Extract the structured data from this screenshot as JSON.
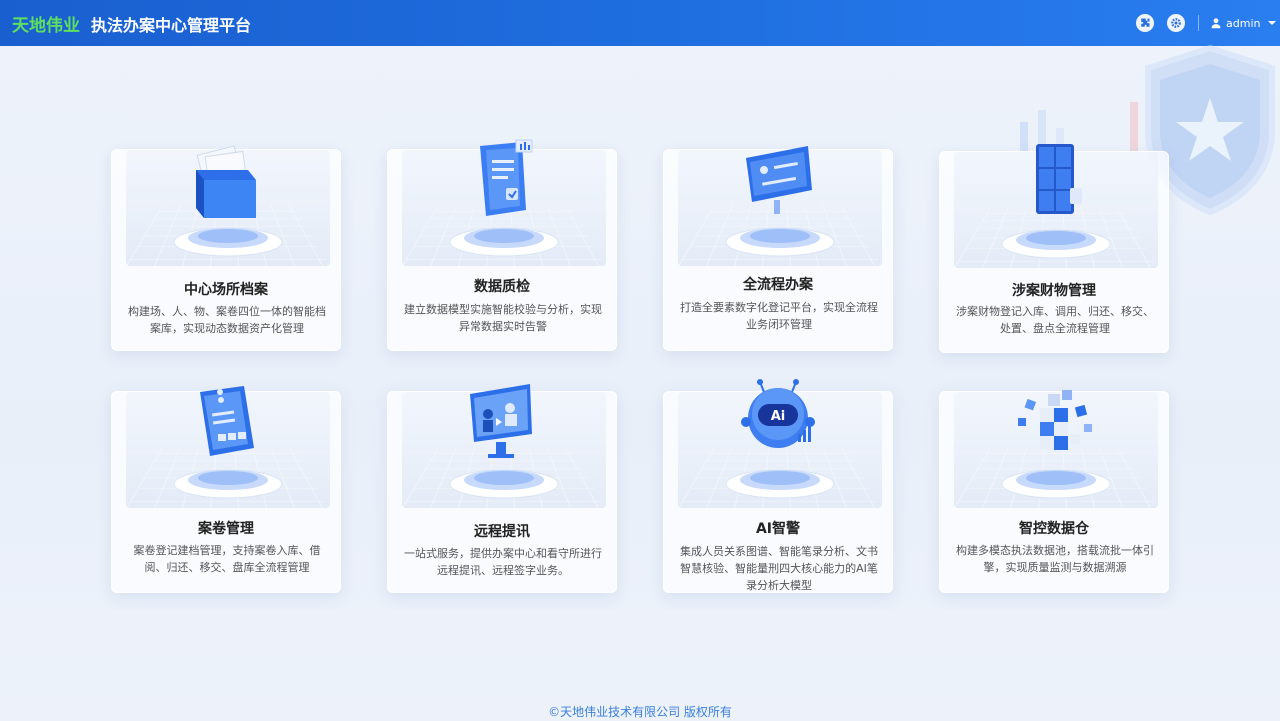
{
  "header": {
    "brand": "天地伟业",
    "title": "执法办案中心管理平台",
    "user": "admin",
    "icons": [
      "puzzle-icon",
      "gear-icon",
      "user-icon"
    ]
  },
  "colors": {
    "header_start": "#1a5fd0",
    "header_end": "#2a7ef0",
    "brand": "#5ee05e",
    "accent": "#2f7cf0",
    "footer_text": "#3a7fd9"
  },
  "cards": [
    {
      "title": "中心场所档案",
      "desc": "构建场、人、物、案卷四位一体的智能档案库，实现动态数据资产化管理",
      "icon": "folder-icon"
    },
    {
      "title": "数据质检",
      "desc": "建立数据模型实施智能校验与分析，实现异常数据实时告警",
      "icon": "document-check-icon"
    },
    {
      "title": "全流程办案",
      "desc": "打造全要素数字化登记平台，实现全流程业务闭环管理",
      "icon": "workflow-screen-icon"
    },
    {
      "title": "涉案财物管理",
      "desc": "涉案财物登记入库、调用、归还、移交、处置、盘点全流程管理",
      "icon": "locker-icon"
    },
    {
      "title": "案卷管理",
      "desc": "案卷登记建档管理，支持案卷入库、借阅、归还、移交、盘库全流程管理",
      "icon": "file-folder-icon"
    },
    {
      "title": "远程提讯",
      "desc": "一站式服务，提供办案中心和看守所进行远程提讯、远程签字业务。",
      "icon": "monitor-icon"
    },
    {
      "title": "AI智警",
      "desc": "集成人员关系图谱、智能笔录分析、文书智慧核验、智能量刑四大核心能力的AI笔录分析大模型",
      "icon": "ai-robot-icon"
    },
    {
      "title": "智控数据仓",
      "desc": "构建多模态执法数据池，搭载流批一体引擎，实现质量监测与数据溯源",
      "icon": "data-cubes-icon"
    }
  ],
  "footer": {
    "copyright": "©天地伟业技术有限公司 版权所有"
  }
}
